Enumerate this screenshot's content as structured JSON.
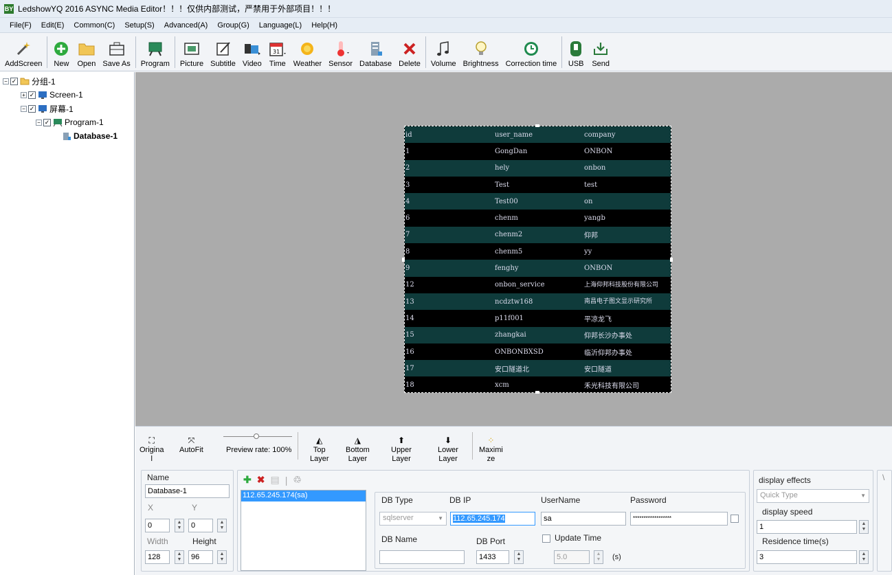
{
  "title": "LedshowYQ 2016 ASYNC Media Editor！！！仅供内部测试，严禁用于外部项目！！！",
  "app_icon": "BY",
  "menu": [
    "File(F)",
    "Edit(E)",
    "Common(C)",
    "Setup(S)",
    "Advanced(A)",
    "Group(G)",
    "Language(L)",
    "Help(H)"
  ],
  "toolbar": {
    "add_screen": "AddScreen",
    "new": "New",
    "open": "Open",
    "save_as": "Save As",
    "program": "Program",
    "picture": "Picture",
    "subtitle": "Subtitle",
    "video": "Video",
    "time": "Time",
    "weather": "Weather",
    "sensor": "Sensor",
    "database": "Database",
    "delete": "Delete",
    "volume": "Volume",
    "brightness": "Brightness",
    "correction_time": "Correction time",
    "usb": "USB",
    "send": "Send"
  },
  "tree": {
    "group": "分组-1",
    "screen1": "Screen-1",
    "screen2": "屏幕-1",
    "program": "Program-1",
    "database": "Database-1"
  },
  "led_table": {
    "header": [
      "id",
      "user_name",
      "company"
    ],
    "rows": [
      [
        "1",
        "GongDan",
        "ONBON"
      ],
      [
        "2",
        "hely",
        "onbon"
      ],
      [
        "3",
        "Test",
        "test"
      ],
      [
        "4",
        "Test00",
        "on"
      ],
      [
        "6",
        "chenm",
        "yangb"
      ],
      [
        "7",
        "chenm2",
        "仰邦"
      ],
      [
        "8",
        "chenm5",
        "yy"
      ],
      [
        "9",
        "fenghy",
        "ONBON"
      ],
      [
        "12",
        "onbon_service",
        "上海仰邦科技股份有限公司"
      ],
      [
        "13",
        "ncdztw168",
        "南昌电子图文显示研究所"
      ],
      [
        "14",
        "p11f001",
        "平凉龙飞"
      ],
      [
        "15",
        "zhangkai",
        "仰邦长沙办事处"
      ],
      [
        "16",
        "ONBONBXSD",
        "临沂仰邦办事处"
      ],
      [
        "17",
        "安口隧道北",
        "安口隧道"
      ],
      [
        "18",
        "xcm",
        "禾光科技有限公司"
      ]
    ]
  },
  "bottom_toolbar": {
    "original": "Origina\nl",
    "autofit": "AutoFit",
    "preview_rate": "Preview rate: 100%",
    "top_layer": "Top\nLayer",
    "bottom_layer": "Bottom\nLayer",
    "upper_layer": "Upper\nLayer",
    "lower_layer": "Lower\nLayer",
    "maximize": "Maximi\nze"
  },
  "props": {
    "name_label": "Name",
    "name_value": "Database-1",
    "x_label": "X",
    "y_label": "Y",
    "x_value": "0",
    "y_value": "0",
    "width_label": "Width",
    "height_label": "Height",
    "width_value": "128",
    "height_value": "96",
    "list_item": "112.65.245.174(sa)",
    "db_type_label": "DB Type",
    "db_type_value": "sqlserver",
    "db_ip_label": "DB IP",
    "db_ip_value": "112.65.245.174",
    "username_label": "UserName",
    "username_value": "sa",
    "password_label": "Password",
    "password_value": "******************",
    "db_name_label": "DB Name",
    "db_name_value": "",
    "db_port_label": "DB Port",
    "db_port_value": "1433",
    "update_time_label": "Update Time",
    "update_time_value": "5.0",
    "update_time_unit": "(s)",
    "display_effects_label": "display effects",
    "display_effects_value": "Quick Type",
    "display_speed_label": "display speed",
    "display_speed_value": "1",
    "residence_label": "Residence time(s)",
    "residence_value": "3",
    "edge_label": "\\"
  }
}
